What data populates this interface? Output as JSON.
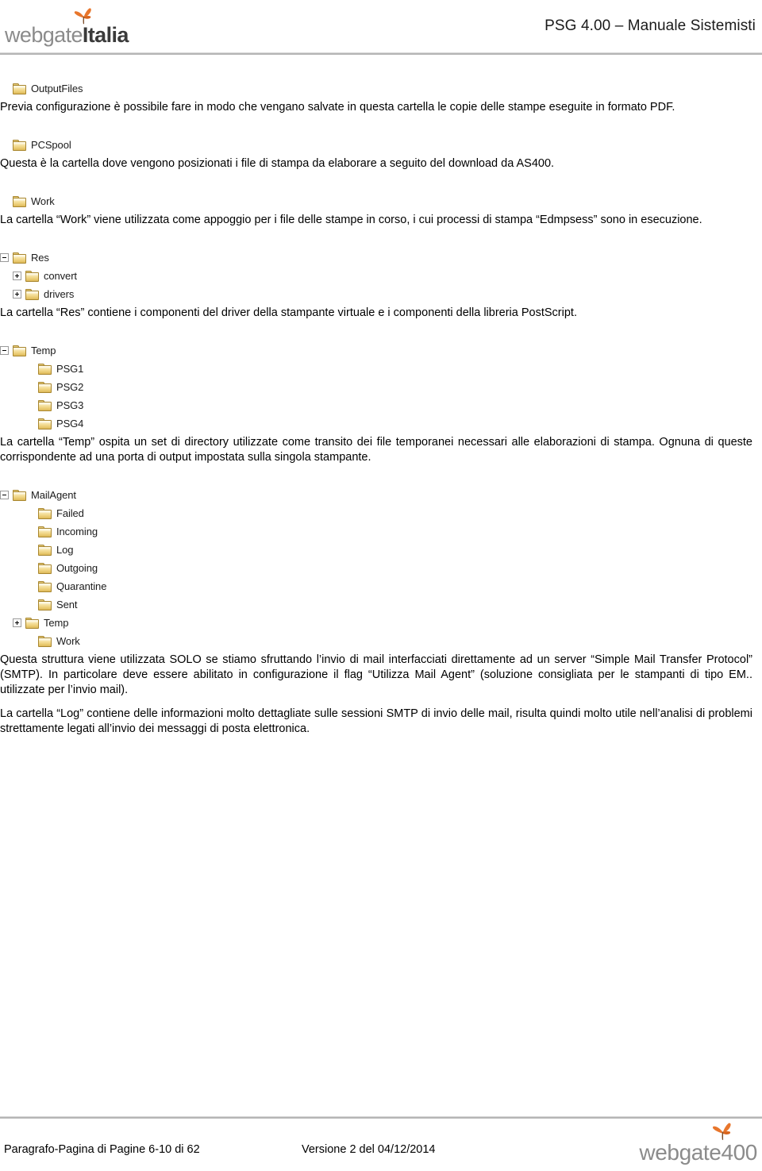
{
  "header": {
    "logo": {
      "text_light": "webgate",
      "text_bold": "Italia",
      "icon": "butterfly-icon",
      "accent_color": "#E8762C"
    },
    "doc_title": "PSG 4.00 – Manuale Sistemisti"
  },
  "sections": [
    {
      "id": "outputfiles",
      "tree": [
        {
          "label": "OutputFiles",
          "depth": 0,
          "expander": "none",
          "icon": "folder-icon"
        }
      ],
      "paragraphs": [
        "Previa configurazione è possibile fare in modo che vengano salvate in questa cartella le copie delle stampe eseguite in formato PDF."
      ]
    },
    {
      "id": "pcspool",
      "tree": [
        {
          "label": "PCSpool",
          "depth": 0,
          "expander": "none",
          "icon": "folder-icon"
        }
      ],
      "paragraphs": [
        "Questa è la cartella dove vengono posizionati i file di stampa da elaborare a seguito del download da AS400."
      ]
    },
    {
      "id": "work",
      "tree": [
        {
          "label": "Work",
          "depth": 0,
          "expander": "none",
          "icon": "folder-icon"
        }
      ],
      "paragraphs": [
        "La cartella “Work” viene utilizzata come appoggio per i file delle stampe in corso, i cui processi di stampa “Edmpsess” sono in esecuzione."
      ]
    },
    {
      "id": "res",
      "tree": [
        {
          "label": "Res",
          "depth": 0,
          "expander": "minus",
          "icon": "folder-icon"
        },
        {
          "label": "convert",
          "depth": 1,
          "expander": "plus",
          "icon": "folder-icon"
        },
        {
          "label": "drivers",
          "depth": 1,
          "expander": "plus",
          "icon": "folder-icon"
        }
      ],
      "paragraphs": [
        "La cartella “Res” contiene i componenti del driver della stampante virtuale e i componenti della libreria PostScript."
      ]
    },
    {
      "id": "temp",
      "tree": [
        {
          "label": "Temp",
          "depth": 0,
          "expander": "minus",
          "icon": "folder-icon"
        },
        {
          "label": "PSG1",
          "depth": 2,
          "expander": "none",
          "icon": "folder-icon"
        },
        {
          "label": "PSG2",
          "depth": 2,
          "expander": "none",
          "icon": "folder-icon"
        },
        {
          "label": "PSG3",
          "depth": 2,
          "expander": "none",
          "icon": "folder-icon"
        },
        {
          "label": "PSG4",
          "depth": 2,
          "expander": "none",
          "icon": "folder-icon"
        }
      ],
      "paragraphs": [
        "La cartella “Temp” ospita un set di directory utilizzate come transito dei file temporanei necessari alle elaborazioni di stampa. Ognuna di queste corrispondente ad una porta di output impostata sulla singola stampante."
      ]
    },
    {
      "id": "mailagent",
      "tree": [
        {
          "label": "MailAgent",
          "depth": 0,
          "expander": "minus",
          "icon": "folder-icon"
        },
        {
          "label": "Failed",
          "depth": 2,
          "expander": "none",
          "icon": "folder-icon"
        },
        {
          "label": "Incoming",
          "depth": 2,
          "expander": "none",
          "icon": "folder-icon"
        },
        {
          "label": "Log",
          "depth": 2,
          "expander": "none",
          "icon": "folder-icon"
        },
        {
          "label": "Outgoing",
          "depth": 2,
          "expander": "none",
          "icon": "folder-icon"
        },
        {
          "label": "Quarantine",
          "depth": 2,
          "expander": "none",
          "icon": "folder-icon"
        },
        {
          "label": "Sent",
          "depth": 2,
          "expander": "none",
          "icon": "folder-icon"
        },
        {
          "label": "Temp",
          "depth": 1,
          "expander": "plus",
          "icon": "folder-icon"
        },
        {
          "label": "Work",
          "depth": 2,
          "expander": "none",
          "icon": "folder-icon"
        }
      ],
      "paragraphs": [
        "Questa struttura viene utilizzata SOLO se stiamo sfruttando l’invio di mail interfacciati direttamente ad un server “Simple Mail Transfer Protocol” (SMTP). In particolare deve essere abilitato in configurazione il flag “Utilizza Mail Agent” (soluzione consigliata per le stampanti di tipo EM.. utilizzate per l’invio mail).",
        "La cartella “Log” contiene delle informazioni molto dettagliate sulle sessioni SMTP di invio delle mail, risulta quindi molto utile nell’analisi di problemi strettamente legati all’invio dei messaggi di posta elettronica."
      ]
    }
  ],
  "footer": {
    "page_info": "Paragrafo-Pagina di Pagine 6-10 di 62",
    "version_info": "Versione 2 del 04/12/2014",
    "logo": {
      "text": "webgate400",
      "icon": "butterfly-icon",
      "accent_color": "#E8762C"
    }
  }
}
